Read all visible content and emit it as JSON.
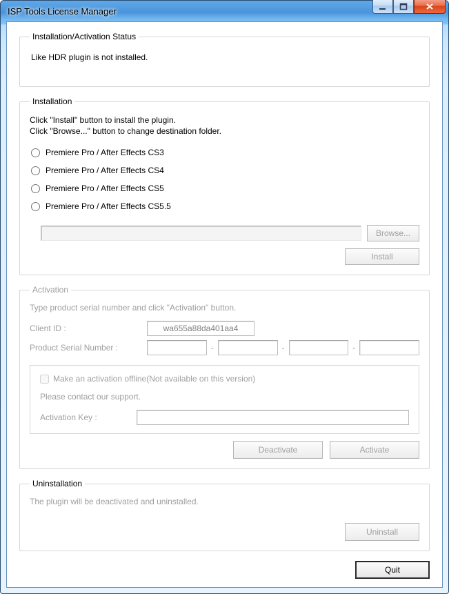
{
  "window": {
    "title": "ISP Tools License Manager"
  },
  "status": {
    "legend": "Installation/Activation Status",
    "message": "Like HDR plugin is not installed."
  },
  "installation": {
    "legend": "Installation",
    "instr_line1": "Click \"Install\" button to install the plugin.",
    "instr_line2": "Click \"Browse...\" button to change destination folder.",
    "options": [
      "Premiere Pro / After Effects  CS3",
      "Premiere Pro / After Effects  CS4",
      "Premiere Pro / After Effects  CS5",
      "Premiere Pro / After Effects  CS5.5"
    ],
    "path_value": "",
    "browse_label": "Browse...",
    "install_label": "Install"
  },
  "activation": {
    "legend": "Activation",
    "note": "Type product serial number and click \"Activation\" button.",
    "client_id_label": "Client ID :",
    "client_id_value": "wa655a88da401aa4",
    "serial_label": "Product Serial Number :",
    "serial_parts": [
      "",
      "",
      "",
      ""
    ],
    "offline_label": "Make an activation offline(Not available on this version)",
    "support_text": "Please contact our support.",
    "activation_key_label": "Activation Key :",
    "activation_key_value": "",
    "deactivate_label": "Deactivate",
    "activate_label": "Activate"
  },
  "uninstallation": {
    "legend": "Uninstallation",
    "note": "The plugin will be deactivated and uninstalled.",
    "uninstall_label": "Uninstall"
  },
  "quit_label": "Quit"
}
